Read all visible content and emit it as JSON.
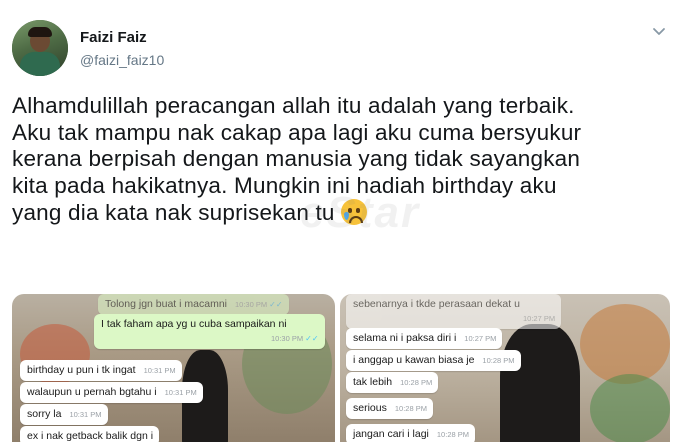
{
  "user": {
    "name": "Faizi Faiz",
    "handle": "@faizi_faiz10"
  },
  "tweet": {
    "lines": [
      "Alhamdulillah peracangan allah itu adalah yang terbaik.",
      "Aku tak mampu nak cakap apa lagi aku cuma bersyukur",
      "kerana berpisah dengan manusia yang tidak sayangkan",
      "kita pada hakikatnya. Mungkin ini hadiah birthday aku",
      "yang dia kata nak suprisekan tu"
    ],
    "emoji": "crying-face-emoji"
  },
  "watermark": "eStar",
  "icons": {
    "menu": "chevron-down-icon"
  },
  "colors": {
    "outgoing_bubble": "#dcf8c6",
    "incoming_bubble": "#ffffff",
    "handle_text": "#657786"
  },
  "screenshot_left": {
    "messages": [
      {
        "text": "Tolong jgn buat i macamni",
        "time": "10:30 PM",
        "dir": "out"
      },
      {
        "text": "I tak faham apa yg u cuba sampaikan ni",
        "time": "10:30 PM",
        "dir": "out"
      },
      {
        "text": "birthday u pun i tk ingat",
        "time": "10:31 PM",
        "dir": "in"
      },
      {
        "text": "walaupun u pernah bgtahu i",
        "time": "10:31 PM",
        "dir": "in"
      },
      {
        "text": "sorry la",
        "time": "10:31 PM",
        "dir": "in"
      },
      {
        "text": "ex i nak getback balik dgn i",
        "time": "",
        "dir": "in"
      }
    ]
  },
  "screenshot_right": {
    "messages": [
      {
        "text": "sebenarnya i tkde perasaan dekat u",
        "time": "10:27 PM",
        "dir": "in"
      },
      {
        "text": "selama ni i paksa diri i",
        "time": "10:27 PM",
        "dir": "in"
      },
      {
        "text": "i anggap u kawan biasa je",
        "time": "10:28 PM",
        "dir": "in"
      },
      {
        "text": "tak lebih",
        "time": "10:28 PM",
        "dir": "in"
      },
      {
        "text": "serious",
        "time": "10:28 PM",
        "dir": "in"
      },
      {
        "text": "jangan cari i lagi",
        "time": "10:28 PM",
        "dir": "in"
      }
    ]
  }
}
